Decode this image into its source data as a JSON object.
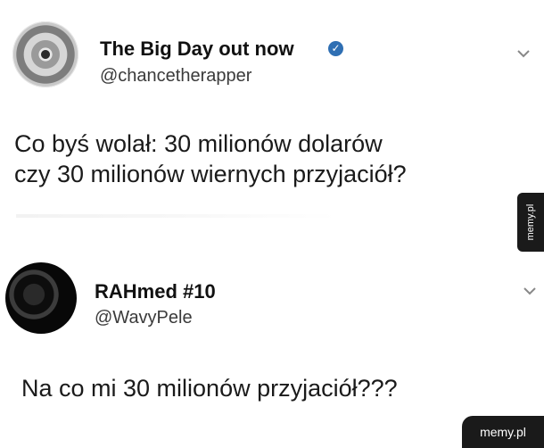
{
  "tweets": [
    {
      "display_name": "The Big Day out now",
      "handle": "@chancetherapper",
      "verified": true,
      "text_lines": [
        "Co byś wolał: 30 milionów dolarów",
        "czy 30 milionów wiernych przyjaciół?"
      ],
      "avatar_icon": "disc-avatar-icon",
      "menu_icon": "chevron-down-icon"
    },
    {
      "display_name": "RAHmed #10",
      "handle": "@WavyPele",
      "verified": false,
      "text_lines": [
        "Na co mi 30 milionów przyjaciół???"
      ],
      "avatar_icon": "dark-photo-avatar-icon",
      "menu_icon": "chevron-down-icon"
    }
  ],
  "watermarks": {
    "side": "memy.pl",
    "corner": "memy.pl"
  },
  "colors": {
    "verified_badge": "#2f6fb3",
    "watermark_bg": "#1a1a1a",
    "text": "#1a1a1a"
  }
}
